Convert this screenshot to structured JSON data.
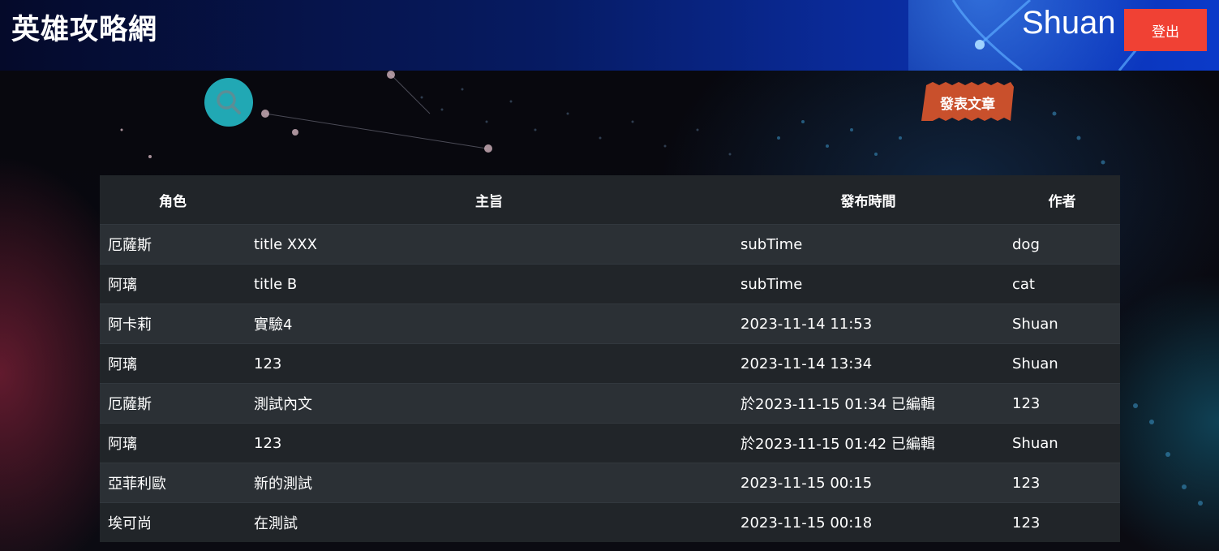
{
  "header": {
    "site_title": "英雄攻略網",
    "username": "Shuan",
    "logout_label": "登出"
  },
  "toolbar": {
    "search_icon": "search-icon",
    "publish_label": "發表文章"
  },
  "table": {
    "columns": [
      "角色",
      "主旨",
      "發布時間",
      "作者"
    ],
    "rows": [
      {
        "role": "厄薩斯",
        "title": "title XXX",
        "time": "subTime",
        "author": "dog"
      },
      {
        "role": "阿璃",
        "title": "title B",
        "time": "subTime",
        "author": "cat"
      },
      {
        "role": "阿卡莉",
        "title": "實驗4",
        "time": "2023-11-14 11:53",
        "author": "Shuan"
      },
      {
        "role": "阿璃",
        "title": "123",
        "time": "2023-11-14 13:34",
        "author": "Shuan"
      },
      {
        "role": "厄薩斯",
        "title": "測試內文",
        "time": "於2023-11-15 01:34 已編輯",
        "author": "123"
      },
      {
        "role": "阿璃",
        "title": "123",
        "time": "於2023-11-15 01:42 已編輯",
        "author": "Shuan"
      },
      {
        "role": "亞菲利歐",
        "title": "新的測試",
        "time": "2023-11-15 00:15",
        "author": "123"
      },
      {
        "role": "埃可尚",
        "title": "在測試",
        "time": "2023-11-15 00:18",
        "author": "123"
      }
    ]
  },
  "colors": {
    "header_dark": "#050a2a",
    "header_light": "#0b3ac9",
    "logout_button": "#f04134",
    "search_button": "#21a8b4",
    "publish_button": "#c9502c",
    "table_row_dark": "#212529",
    "table_row_light": "#2b3035"
  }
}
